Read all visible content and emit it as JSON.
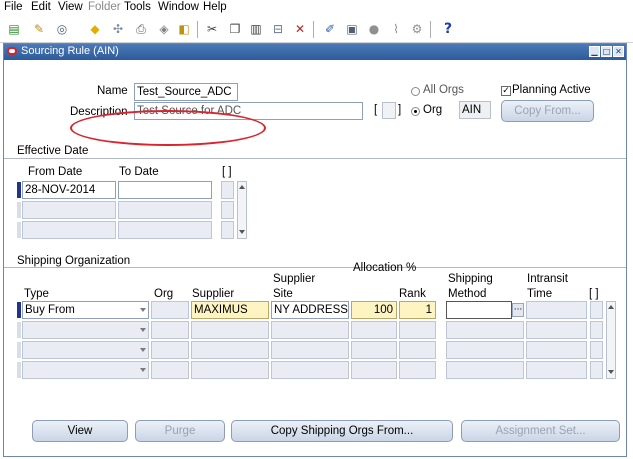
{
  "menu": {
    "items": [
      {
        "label": "File",
        "key": "F"
      },
      {
        "label": "Edit",
        "key": "E"
      },
      {
        "label": "View",
        "key": "V"
      },
      {
        "label": "Folder",
        "key": "",
        "disabled": true
      },
      {
        "label": "Tools",
        "key": "T"
      },
      {
        "label": "Window",
        "key": "W"
      },
      {
        "label": "Help",
        "key": "H"
      }
    ]
  },
  "toolbar": {
    "help_glyph": "?"
  },
  "window": {
    "title": "Sourcing Rule (AIN)"
  },
  "header": {
    "name_label": "Name",
    "name_value": "Test_Source_ADC",
    "description_label": "Description",
    "description_value": "Test Source for ADC",
    "all_orgs_label": "All Orgs",
    "org_label": "Org",
    "org_value": "AIN",
    "planning_active_label": "Planning Active",
    "planning_active_checked": true,
    "copy_from_label": "Copy From...",
    "bracket_open": "[",
    "bracket_close": "]"
  },
  "effective_date": {
    "section_title": "Effective Date",
    "from_date_header": "From Date",
    "to_date_header": "To Date",
    "brackets": "[ ]",
    "rows": [
      {
        "from": "28-NOV-2014",
        "to": ""
      },
      {
        "from": "",
        "to": ""
      },
      {
        "from": "",
        "to": ""
      }
    ]
  },
  "shipping": {
    "section_title": "Shipping Organization",
    "allocation_header": "Allocation %",
    "headers": {
      "type": "Type",
      "org": "Org",
      "supplier": "Supplier",
      "supplier_site_1": "Supplier",
      "supplier_site_2": "Site",
      "rank": "Rank",
      "shipping_method_1": "Shipping",
      "shipping_method_2": "Method",
      "intransit_1": "Intransit",
      "intransit_2": "Time",
      "brackets": "[ ]"
    },
    "rows": [
      {
        "type": "Buy From",
        "org": "",
        "supplier": "MAXIMUS",
        "site": "NY ADDRESS",
        "allocation": "100",
        "rank": "1",
        "method": "",
        "intransit": ""
      },
      {
        "type": "",
        "org": "",
        "supplier": "",
        "site": "",
        "allocation": "",
        "rank": "",
        "method": "",
        "intransit": ""
      },
      {
        "type": "",
        "org": "",
        "supplier": "",
        "site": "",
        "allocation": "",
        "rank": "",
        "method": "",
        "intransit": ""
      },
      {
        "type": "",
        "org": "",
        "supplier": "",
        "site": "",
        "allocation": "",
        "rank": "",
        "method": "",
        "intransit": ""
      }
    ]
  },
  "buttons": {
    "view": "View",
    "purge": "Purge",
    "copy_shipping": "Copy Shipping Orgs From...",
    "assignment_set": "Assignment Set..."
  },
  "colors": {
    "title_bar": "#3a68a8",
    "required_field": "#fef4c2",
    "annotation": "#d9262e"
  }
}
